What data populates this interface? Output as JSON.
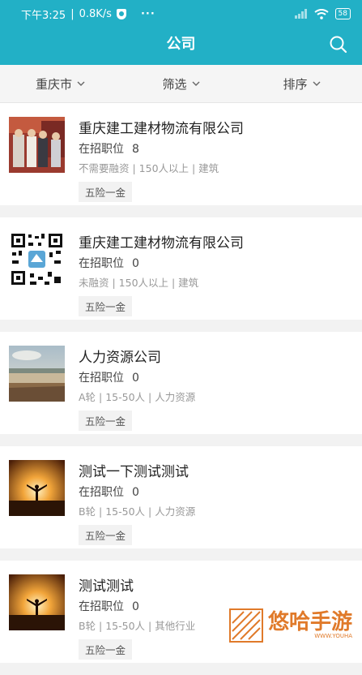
{
  "status_bar": {
    "time": "下午3:25",
    "speed": "0.8K/s",
    "more": "···",
    "battery": "58"
  },
  "header": {
    "title": "公司"
  },
  "filters": [
    {
      "label": "重庆市"
    },
    {
      "label": "筛选"
    },
    {
      "label": "排序"
    }
  ],
  "companies": [
    {
      "name": "重庆建工建材物流有限公司",
      "jobs_label": "在招职位",
      "jobs_count": "8",
      "meta": "不需要融资 | 150人以上 | 建筑",
      "tag": "五险一金",
      "image": "people-photo"
    },
    {
      "name": "重庆建工建材物流有限公司",
      "jobs_label": "在招职位",
      "jobs_count": "0",
      "meta": "未融资 | 150人以上 | 建筑",
      "tag": "五险一金",
      "image": "qr-code"
    },
    {
      "name": "人力资源公司",
      "jobs_label": "在招职位",
      "jobs_count": "0",
      "meta": "A轮 | 15-50人 | 人力资源",
      "tag": "五险一金",
      "image": "landscape-photo"
    },
    {
      "name": "测试一下测试测试",
      "jobs_label": "在招职位",
      "jobs_count": "0",
      "meta": "B轮 | 15-50人 | 人力资源",
      "tag": "五险一金",
      "image": "sunset-person-photo"
    },
    {
      "name": "测试测试",
      "jobs_label": "在招职位",
      "jobs_count": "0",
      "meta": "B轮 | 15-50人 | 其他行业",
      "tag": "五险一金",
      "image": "sunset-person-photo"
    }
  ],
  "watermark": {
    "text": "悠哈手游",
    "sub": "WWW.YOUHA"
  },
  "colors": {
    "primary": "#22b0c6",
    "background": "#f2f2f2"
  }
}
